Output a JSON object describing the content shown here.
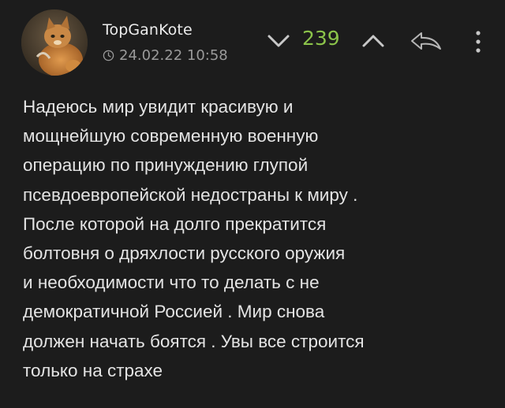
{
  "comment": {
    "author": "TopGanKote",
    "timestamp": "24.02.22 10:58",
    "rating": "239",
    "rating_color": "#8bc34a",
    "icons": {
      "vote_down": "chevron-down-icon",
      "vote_up": "chevron-up-icon",
      "reply": "reply-arrow-icon",
      "more": "more-vertical-icon",
      "clock": "clock-icon"
    },
    "body_lines": [
      "Надеюсь мир увидит красивую и",
      "мощнейшую современную военную",
      "операцию по принуждению глупой",
      "псевдоевропейской недостраны к миру .",
      "После которой на долго прекратится",
      "болтовня о дряхлости русского оружия",
      "и необходимости что то делать с не",
      "демократичной Россией . Мир снова",
      "должен начать боятся . Увы все строится",
      "только на страхе"
    ]
  }
}
